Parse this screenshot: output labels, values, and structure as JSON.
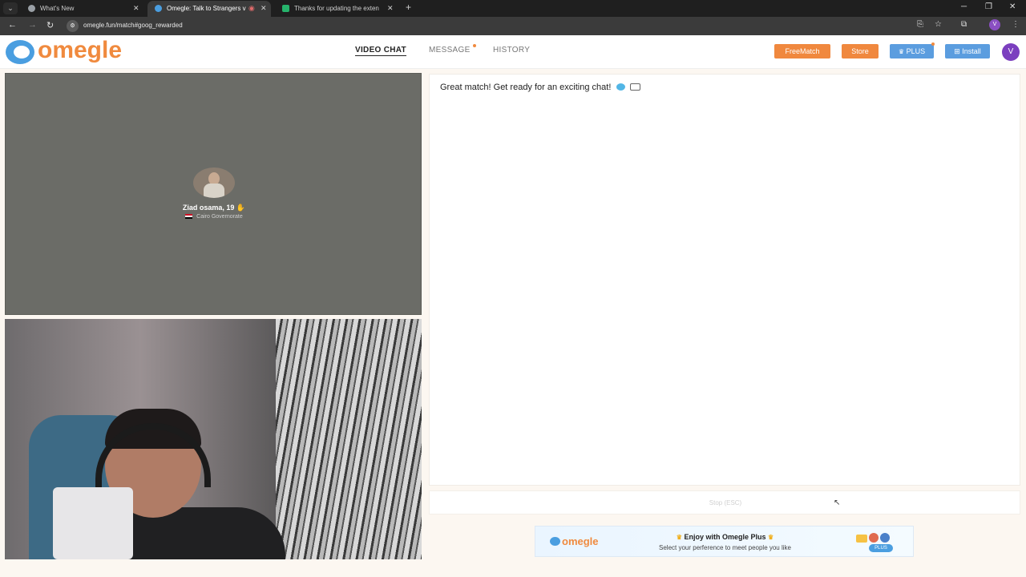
{
  "browser": {
    "tabs": [
      {
        "title": "What's New",
        "active": false
      },
      {
        "title": "Omegle: Talk to Strangers v",
        "active": true
      },
      {
        "title": "Thanks for updating the exten",
        "active": false
      }
    ],
    "new_tab": "+",
    "url": "omegle.fun/match#goog_rewarded",
    "profile_initial": "V"
  },
  "header": {
    "logo_text": "omegle",
    "nav": [
      {
        "label": "VIDEO CHAT",
        "active": true
      },
      {
        "label": "MESSAGE",
        "active": false
      },
      {
        "label": "HISTORY",
        "active": false
      }
    ],
    "buttons": {
      "freematch": "FreeMatch",
      "store": "Store",
      "plus": "PLUS",
      "install": "Install"
    },
    "avatar_initial": "V"
  },
  "remote": {
    "name": "Ziad osama, 19",
    "location": "Cairo Governorate"
  },
  "chat": {
    "message": "Great match! Get ready for an exciting chat!",
    "stop_label": "Stop (ESC)"
  },
  "banner": {
    "logo_text": "omegle",
    "title": "Enjoy with Omegle Plus",
    "subtitle": "Select your perference to meet people you like",
    "badge": "PLUS"
  },
  "colors": {
    "brand_orange": "#f0883e",
    "brand_blue": "#5b9ddf"
  }
}
